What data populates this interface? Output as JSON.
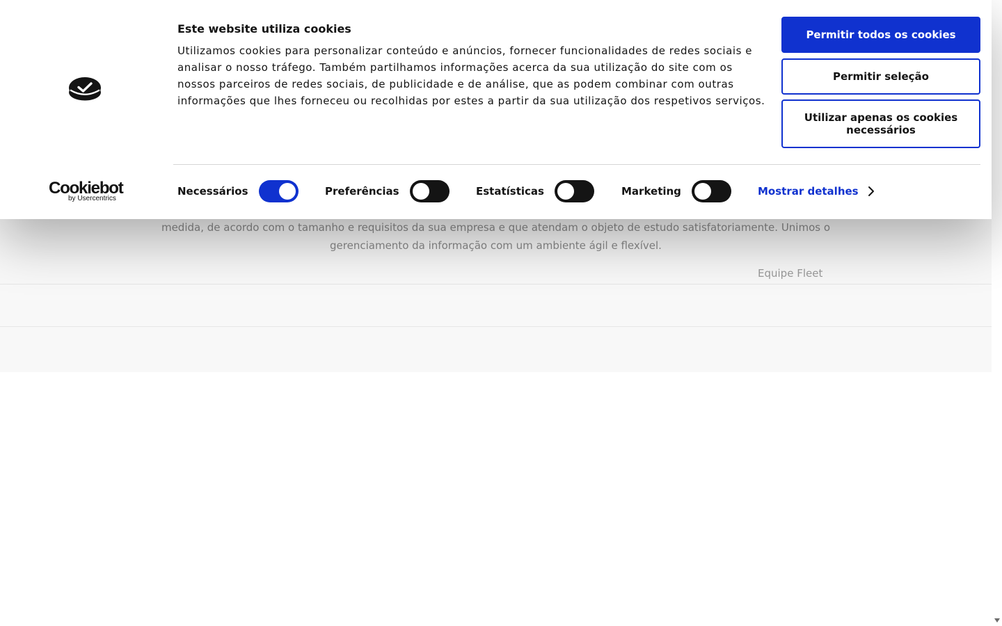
{
  "banner": {
    "title": "Este website utiliza cookies",
    "body": "Utilizamos cookies para personalizar conteúdo e anúncios, fornecer funcionalidades de redes sociais e analisar o nosso tráfego. Também partilhamos informações acerca da sua utilização do site com os nossos parceiros de redes sociais, de publicidade e de análise, que as podem combinar com outras informações que lhes forneceu ou recolhidas por estes a partir da sua utilização dos respetivos serviços.",
    "buttons": {
      "allow_all": "Permitir todos os cookies",
      "allow_selection": "Permitir seleção",
      "necessary_only": "Utilizar apenas os cookies necessários"
    },
    "toggles": [
      {
        "label": "Necessários",
        "checked": true
      },
      {
        "label": "Preferências",
        "checked": false
      },
      {
        "label": "Estatísticas",
        "checked": false
      },
      {
        "label": "Marketing",
        "checked": false
      }
    ],
    "details_link": "Mostrar detalhes",
    "brand": {
      "name": "Cookiebot",
      "sub": "by Usercentrics"
    },
    "icons": {
      "logo": "brand-check-logo-icon",
      "details": "chevron-right-icon"
    },
    "colors": {
      "accent": "#1032cf",
      "text": "#141414",
      "toggle_off": "#141414"
    }
  },
  "page": {
    "text_line1": "medida, de acordo com o tamanho e requisitos da sua empresa e que atendam o objeto de estudo satisfatoriamente. Unimos o",
    "text_line2": "gerenciamento da informação com um ambiente ágil e flexível.",
    "signature": "Equipe Fleet"
  }
}
